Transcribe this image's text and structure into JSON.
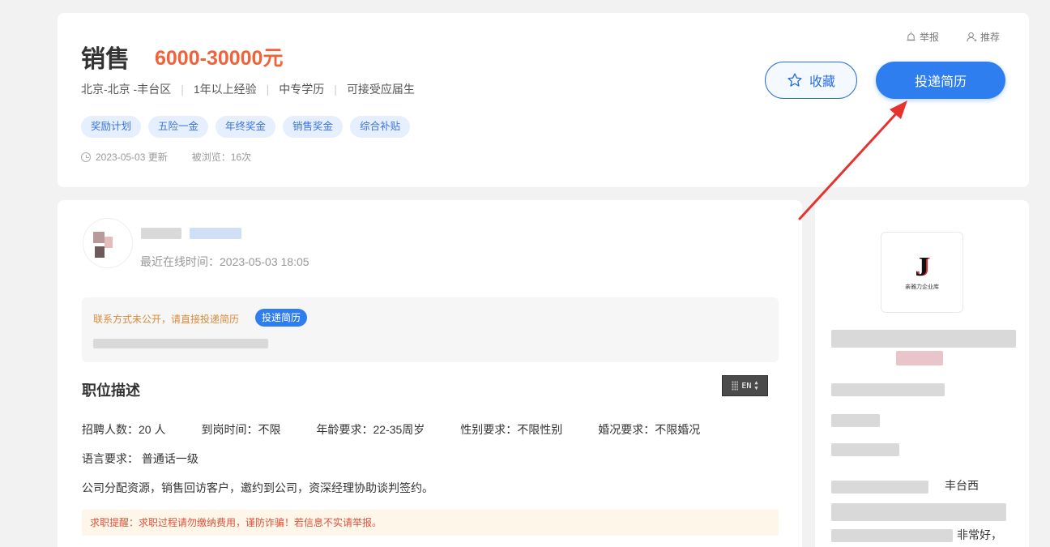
{
  "job": {
    "title": "销售",
    "salary": "6000-30000元",
    "location": "北京-北京 -丰台区",
    "experience": "1年以上经验",
    "education": "中专学历",
    "graduates": "可接受应届生",
    "tags": [
      "奖励计划",
      "五险一金",
      "年终奖金",
      "销售奖金",
      "综合补贴"
    ],
    "updated": "2023-05-03 更新",
    "views": "被浏览：16次"
  },
  "actions": {
    "report_label": "举报",
    "recommend_label": "推荐",
    "collect_label": "收藏",
    "apply_label": "投递简历"
  },
  "recruiter": {
    "login_time": "最近在线时间：2023-05-03 18:05"
  },
  "contact": {
    "hint": "联系方式未公开，请直接投递简历",
    "apply_small_label": "投递简历"
  },
  "description": {
    "section_title": "职位描述",
    "lang_widget": "EN",
    "requirements": [
      "招聘人数：20 人",
      "到岗时间：不限",
      "年龄要求：22-35周岁",
      "性别要求：不限性别",
      "婚况要求：不限婚况"
    ],
    "language": "语言要求： 普通话一级",
    "text": "公司分配资源，销售回访客户，邀约到公司，资深经理协助谈判签约。",
    "warning": "求职提醒：求职过程请勿缴纳费用，谨防诈骗！若信息不实请举报。"
  },
  "company": {
    "logo_letter": "J",
    "logo_caption": "亲雅力企业库",
    "text_fragment_1": "丰台西",
    "text_fragment_2": "非常好，"
  },
  "colors": {
    "salary": "#f0623a",
    "primary": "#2f7ef0",
    "tag_bg": "#e6effd",
    "warning_bg": "#fdf6e9",
    "warning_text": "#e0523a",
    "annotation_arrow": "#e8322e"
  }
}
